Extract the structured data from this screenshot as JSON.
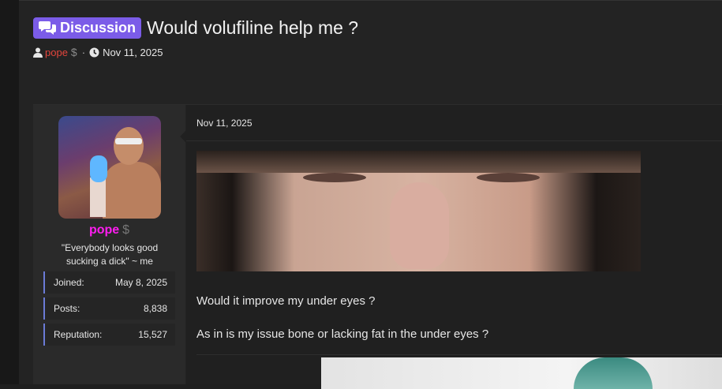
{
  "thread": {
    "badge_label": "Discussion",
    "title": "Would volufiline help me ?",
    "author": "pope",
    "author_icon": "dollar-sign",
    "separator": "·",
    "date": "Nov 11, 2025"
  },
  "user": {
    "name": "pope",
    "name_color": "#ff1df0",
    "custom_title": "\"Everybody looks good sucking a dick\" ~ me",
    "stats": [
      {
        "label": "Joined:",
        "value": "May 8, 2025"
      },
      {
        "label": "Posts:",
        "value": "8,838"
      },
      {
        "label": "Reputation:",
        "value": "15,527"
      }
    ]
  },
  "post": {
    "date": "Nov 11, 2025",
    "lines": [
      "Would it improve my under eyes ?",
      "As in is my issue bone or lacking fat in the under eyes ?"
    ]
  },
  "colors": {
    "badge": "#7b5ce8",
    "author_link": "#e2453c",
    "stat_accent": "#6b7bd6",
    "background": "#1f1f1f"
  }
}
